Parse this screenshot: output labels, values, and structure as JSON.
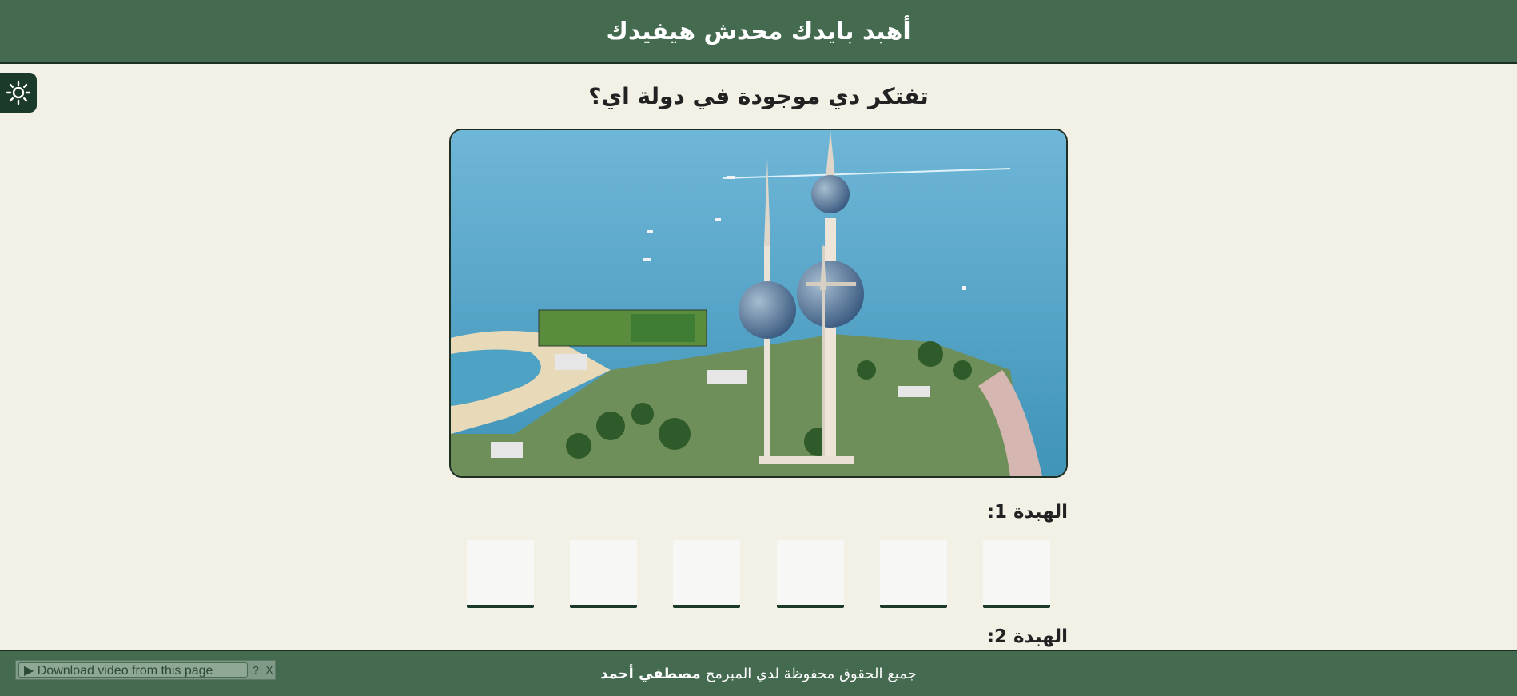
{
  "header": {
    "title": "أهبد بايدك محدش هيفيدك"
  },
  "theme_toggle": {
    "icon": "sun-icon"
  },
  "quiz": {
    "question": "تفتكر دي موجودة في دولة اي؟",
    "image_alt": "Kuwait Towers"
  },
  "hints": [
    {
      "label": "الهبدة 1:",
      "boxes": 6
    },
    {
      "label": "الهبدة 2:"
    }
  ],
  "footer": {
    "text": "جميع الحقوق محفوظة لدي المبرمج",
    "author": "مصطفي أحمد"
  },
  "download_bar": {
    "label": "▶ Download video from this page",
    "help": "?",
    "close": "X"
  },
  "colors": {
    "header": "#446a50",
    "background": "#f3f0e6",
    "accent": "#1c3a29"
  }
}
